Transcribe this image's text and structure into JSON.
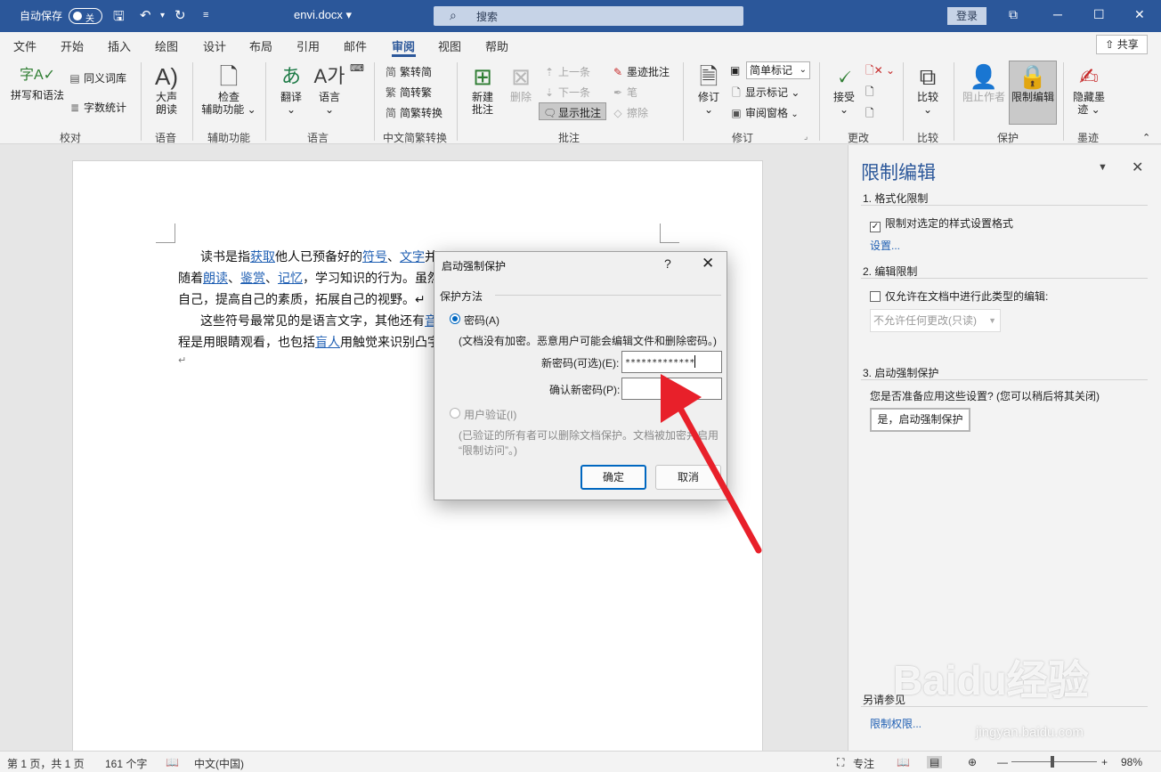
{
  "titlebar": {
    "autosave_label": "自动保存",
    "autosave_state": "关",
    "doc_name": "envi.docx ▾",
    "search_placeholder": "搜索",
    "login_label": "登录",
    "colors": {
      "titlebar_bg": "#2b579a",
      "accent": "#2b579a"
    }
  },
  "tabs": [
    "文件",
    "开始",
    "插入",
    "绘图",
    "设计",
    "布局",
    "引用",
    "邮件",
    "审阅",
    "视图",
    "帮助"
  ],
  "active_tab": "审阅",
  "share_label": "共享",
  "ribbon": {
    "proofing": {
      "spell": "拼写和语法",
      "thesaurus": "同义词库",
      "wordcount": "字数统计",
      "group": "校对"
    },
    "speech": {
      "read_aloud_1": "大声",
      "read_aloud_2": "朗读",
      "group": "语音"
    },
    "accessibility": {
      "check_1": "检查",
      "check_2": "辅助功能 ⌄",
      "group": "辅助功能"
    },
    "language": {
      "translate": "翻译",
      "translate_arrow": "⌄",
      "language": "语言",
      "language_arrow": "⌄",
      "group": "语言"
    },
    "chinese": {
      "t2s": "繁转简",
      "s2t": "简转繁",
      "convert": "简繁转换",
      "group": "中文简繁转换"
    },
    "comments": {
      "new_1": "新建",
      "new_2": "批注",
      "delete": "删除",
      "prev": "上一条",
      "next": "下一条",
      "show": "显示批注",
      "ink": "墨迹批注",
      "pen": "笔",
      "erase": "擦除",
      "group": "批注"
    },
    "tracking": {
      "track": "修订",
      "track_arrow": "⌄",
      "markup": "简单标记",
      "show_markup": "显示标记 ⌄",
      "pane": "审阅窗格",
      "group": "修订"
    },
    "changes": {
      "accept": "接受",
      "accept_arrow": "⌄",
      "group": "更改"
    },
    "compare": {
      "compare": "比较",
      "compare_arrow": "⌄",
      "group": "比较"
    },
    "protect": {
      "block_authors": "阻止作者",
      "restrict": "限制编辑",
      "group": "保护"
    },
    "ink": {
      "hide_1": "隐藏墨",
      "hide_2": "迹 ⌄",
      "group": "墨迹"
    }
  },
  "document": {
    "line1_a": "读书是指",
    "line1_link1": "获取",
    "line1_b": "他人已预备好的",
    "line1_link2": "符号",
    "line1_c": "、",
    "line1_link3": "文字",
    "line1_d": "并",
    "line2_a": "随着",
    "line2_link1": "朗读",
    "line2_b": "、",
    "line2_link2": "鉴赏",
    "line2_c": "、",
    "line2_link3": "记忆",
    "line2_d": "，学习知识的行为。虽然",
    "line3": "自己，提高自己的素质，拓展自己的视野。↵",
    "line4_a": "这些符号最常见的是语言文字，其他还有",
    "line4_link": "音",
    "line5_a": "程是用眼睛观看，也包括",
    "line5_link": "盲人",
    "line5_b": "用触觉来识别凸字",
    "line6": "↵"
  },
  "pane": {
    "title": "限制编辑",
    "section1": "1. 格式化限制",
    "format_check": "限制对选定的样式设置格式",
    "settings_link": "设置...",
    "section2": "2. 编辑限制",
    "edit_check": "仅允许在文档中进行此类型的编辑:",
    "edit_select": "不允许任何更改(只读)",
    "section3": "3. 启动强制保护",
    "ready_text": "您是否准备应用这些设置? (您可以稍后将其关闭)",
    "start_button": "是，启动强制保护",
    "see_also": "另请参见",
    "permission_link": "限制权限..."
  },
  "dialog": {
    "title": "启动强制保护",
    "help": "?",
    "section": "保护方法",
    "password_radio": "密码(A)",
    "password_note": "(文档没有加密。恶意用户可能会编辑文件和删除密码。)",
    "new_pwd_label": "新密码(可选)(E):",
    "new_pwd_value": "*************",
    "confirm_label": "确认新密码(P):",
    "confirm_value": "",
    "user_auth_radio": "用户验证(I)",
    "user_auth_note_1": "(已验证的所有者可以删除文档保护。文档被加密并启用",
    "user_auth_note_2": "“限制访问”。)",
    "ok": "确定",
    "cancel": "取消"
  },
  "status": {
    "page": "第 1 页，共 1 页",
    "words": "161 个字",
    "lang": "中文(中国)",
    "focus": "专注",
    "zoom": "98%",
    "zoom_minus": "—",
    "zoom_plus": "+"
  },
  "watermark": {
    "brand": "Baidu经验",
    "url": "jingyan.baidu.com"
  },
  "icons": [
    "save-icon",
    "undo-icon",
    "redo-icon",
    "search-icon",
    "ribbon-display-icon",
    "minimize-icon",
    "maximize-icon",
    "close-icon",
    "share-icon",
    "lock-icon"
  ]
}
